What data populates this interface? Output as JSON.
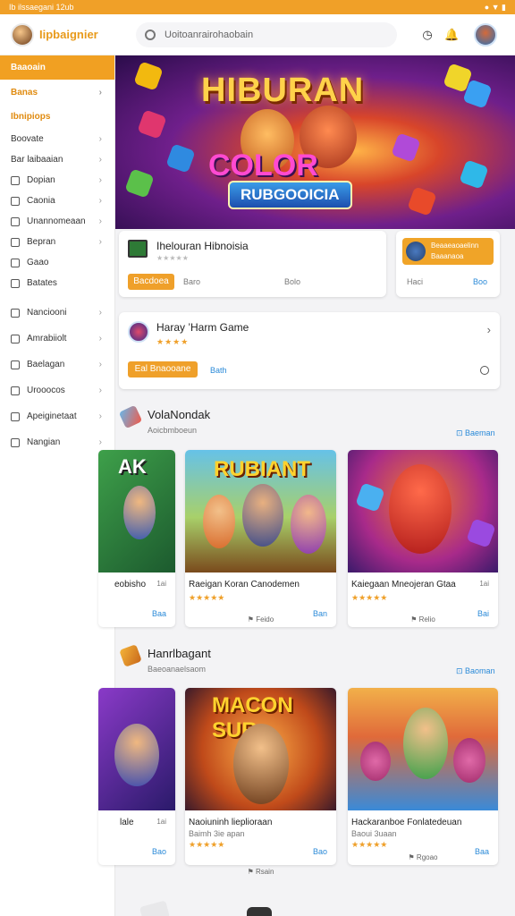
{
  "statusbar": {
    "left": "Ib ilssaegani 12ub",
    "right": "● ▼ ▮"
  },
  "app": {
    "brand": "Iipbaignier"
  },
  "search": {
    "placeholder": "Uoitoanrairohaobain"
  },
  "sidebar": {
    "items": [
      {
        "label": "Baaoain",
        "active": true
      },
      {
        "label": "Banas",
        "orange": true
      },
      {
        "label": "Ibnipiops",
        "orange": true
      },
      {
        "label": "Boovate"
      },
      {
        "label": "Bar laibaaian"
      },
      {
        "label": "Dopian",
        "icon": true
      },
      {
        "label": "Caonia",
        "icon": true
      },
      {
        "label": "Unannomeaan",
        "icon": true
      },
      {
        "label": "Bepran",
        "icon": true
      },
      {
        "label": "Gaao",
        "icon": true
      },
      {
        "label": "Batates",
        "icon": true
      },
      {
        "label": "Nanciooni",
        "icon": true
      },
      {
        "label": "Amrabiiolt",
        "icon": true
      },
      {
        "label": "Baelagan",
        "icon": true
      },
      {
        "label": "Urooocos",
        "icon": true
      },
      {
        "label": "Apeiginetaat",
        "icon": true
      },
      {
        "label": "Nangian",
        "icon": true
      }
    ]
  },
  "hero": {
    "title": "HIBURAN",
    "logo_word": "COLOR",
    "subtitle": "RUBGOOICIA"
  },
  "promo_card": {
    "title": "Ihelouran Hibnoisia",
    "rating": "★★★★★",
    "button": "Bacdoea",
    "label_mid": "Baro",
    "label_right": "Bolo"
  },
  "side_card": {
    "button_line1": "Beaaeaoaelinn",
    "button_line2": "Baaanaoa",
    "label_left": "Haci",
    "label_right": "Boo"
  },
  "featured": {
    "title": "Haray ’Harm Game",
    "rating": "★★★★",
    "button": "Eal Bnaooane",
    "link": "Bath"
  },
  "section1": {
    "title": "VolaNondak",
    "subtitle": "Aoicbmboeun",
    "see_all": "Baeman",
    "games": [
      {
        "banner": "AK",
        "name": "eobisho",
        "size": "1ai",
        "dl": "Baa",
        "sub": ""
      },
      {
        "banner": "RUBIANT",
        "name": "Raeigan Koran Canodemen",
        "size": "",
        "dl": "Ban",
        "stars": "★★★★★",
        "sub": "⚑ Feido"
      },
      {
        "banner": "",
        "name": "Kaiegaan Mneojeran Gtaa",
        "size": "1ai",
        "dl": "Bai",
        "stars": "★★★★★",
        "sub": "⚑ Relio"
      }
    ]
  },
  "section2": {
    "title": "Hanrlbagant",
    "subtitle": "Baeoanaelsaom",
    "see_all": "Baoman",
    "games": [
      {
        "banner": "",
        "name": "lale",
        "size": "1ai",
        "dl": "Bao",
        "sub": ""
      },
      {
        "banner": "MACON SUR",
        "name": "Naoiuninh lieplioraan",
        "size": "",
        "dl": "Bao",
        "rating_text": "Baimh 3ie apan",
        "stars": "★★★★★",
        "sub": "⚑ Rsain"
      },
      {
        "banner": "",
        "name": "Hackaranboe Fonlatedeuan",
        "size": "",
        "dl": "Baa",
        "rating_text": "Baoui 3uaan",
        "stars": "★★★★★",
        "sub": "⚑ Rgoao"
      }
    ]
  }
}
